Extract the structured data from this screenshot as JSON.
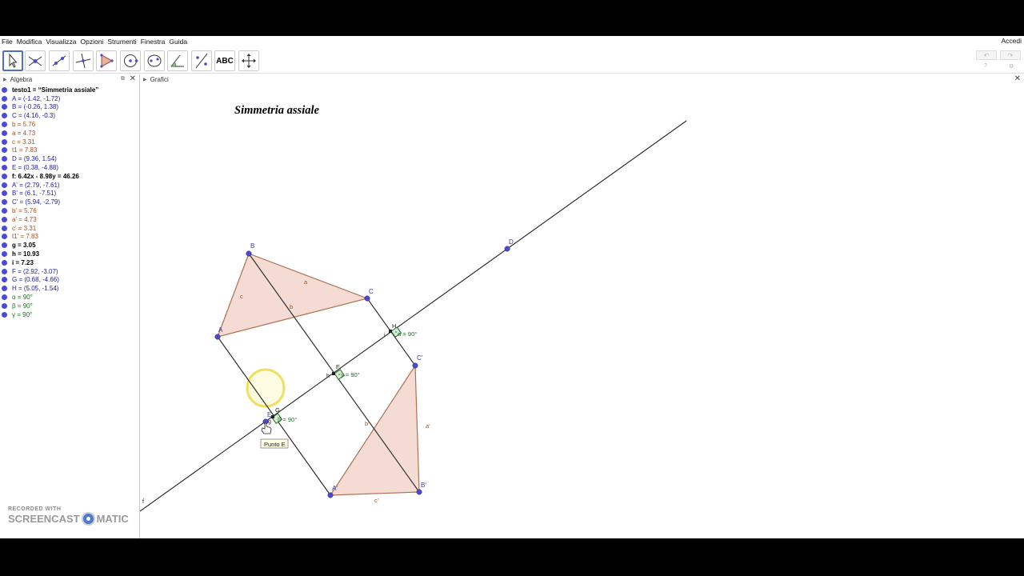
{
  "menu": [
    "File",
    "Modifica",
    "Visualizza",
    "Opzioni",
    "Strumenti",
    "Finestra",
    "Guida"
  ],
  "login_label": "Accedi",
  "toolbar": {
    "tools": [
      {
        "icon": "move-pointer-icon",
        "active": true
      },
      {
        "icon": "point-icon"
      },
      {
        "icon": "line-icon"
      },
      {
        "icon": "perpendicular-line-icon"
      },
      {
        "icon": "polygon-icon"
      },
      {
        "icon": "circle-icon"
      },
      {
        "icon": "ellipse-icon"
      },
      {
        "icon": "angle-icon"
      },
      {
        "icon": "reflect-icon"
      },
      {
        "icon": "text-tool-icon",
        "label": "ABC"
      },
      {
        "icon": "move-view-icon"
      }
    ],
    "undo_icon": "undo-icon",
    "redo_icon": "redo-icon"
  },
  "algebra": {
    "title": "Algebra",
    "rows": [
      {
        "text": "testo1 = “Simmetria assiale”",
        "color": "#000000",
        "bold": true,
        "dot": "#4a4ad8"
      },
      {
        "text": "A = (-1.42, -1.72)",
        "color": "#2020a0",
        "dot": "#4a4ad8"
      },
      {
        "text": "B = (-0.26, 1.38)",
        "color": "#2020a0",
        "dot": "#4a4ad8"
      },
      {
        "text": "C = (4.16, -0.3)",
        "color": "#2020a0",
        "dot": "#4a4ad8"
      },
      {
        "text": "b = 5.76",
        "color": "#a05020",
        "dot": "#4a4ad8"
      },
      {
        "text": "a = 4.73",
        "color": "#a05020",
        "dot": "#4a4ad8"
      },
      {
        "text": "c = 3.31",
        "color": "#a05020",
        "dot": "#4a4ad8"
      },
      {
        "text": "t1 = 7.83",
        "color": "#a05020",
        "dot": "#4a4ad8"
      },
      {
        "text": "D = (9.36, 1.54)",
        "color": "#2020a0",
        "dot": "#4a4ad8"
      },
      {
        "text": "E = (0.38, -4.88)",
        "color": "#2020a0",
        "dot": "#4a4ad8"
      },
      {
        "text": "f: 6.42x - 8.98y = 46.26",
        "color": "#000000",
        "bold": true,
        "dot": "#4a4ad8"
      },
      {
        "text": "A' = (2.79, -7.61)",
        "color": "#2020a0",
        "dot": "#4a4ad8"
      },
      {
        "text": "B' = (6.1, -7.51)",
        "color": "#2020a0",
        "dot": "#4a4ad8"
      },
      {
        "text": "C' = (5.94, -2.79)",
        "color": "#2020a0",
        "dot": "#4a4ad8"
      },
      {
        "text": "b' = 5.76",
        "color": "#a05020",
        "dot": "#4a4ad8"
      },
      {
        "text": "a' = 4.73",
        "color": "#a05020",
        "dot": "#4a4ad8"
      },
      {
        "text": "c' = 3.31",
        "color": "#a05020",
        "dot": "#4a4ad8"
      },
      {
        "text": "t1' = 7.83",
        "color": "#a05020",
        "dot": "#4a4ad8"
      },
      {
        "text": "g = 3.05",
        "color": "#000000",
        "bold": true,
        "dot": "#4a4ad8"
      },
      {
        "text": "h = 10.93",
        "color": "#000000",
        "bold": true,
        "dot": "#4a4ad8"
      },
      {
        "text": "i = 7.23",
        "color": "#000000",
        "bold": true,
        "dot": "#4a4ad8"
      },
      {
        "text": "F = (2.92, -3.07)",
        "color": "#2020a0",
        "dot": "#4a4ad8"
      },
      {
        "text": "G = (0.68, -4.66)",
        "color": "#2020a0",
        "dot": "#4a4ad8"
      },
      {
        "text": "H = (5.05, -1.54)",
        "color": "#2020a0",
        "dot": "#4a4ad8"
      },
      {
        "text": "α = 90°",
        "color": "#207020",
        "dot": "#4a4ad8"
      },
      {
        "text": "β = 90°",
        "color": "#207020",
        "dot": "#4a4ad8"
      },
      {
        "text": "γ = 90°",
        "color": "#207020",
        "dot": "#4a4ad8"
      }
    ]
  },
  "graphics": {
    "title": "Grafici",
    "text_object": "Simmetria assiale",
    "tooltip": "Punto E",
    "colors": {
      "point": "#4a4ad8",
      "triangle_fill": "#f4dcd4",
      "triangle_edge": "#b07050",
      "angle": "#207020",
      "line": "#303030"
    },
    "point_labels": {
      "A": "A",
      "B": "B",
      "C": "C",
      "D": "D",
      "E": "E",
      "F": "F",
      "G": "G",
      "H": "H",
      "A1": "A'",
      "B1": "B'",
      "C1": "C'"
    },
    "segment_labels": {
      "a": "a",
      "b": "b",
      "c": "c",
      "a1": "a'",
      "b1": "b'",
      "c1": "c'",
      "f": "f",
      "g": "g",
      "h": "h",
      "i": "i"
    },
    "angles": [
      {
        "symbol": "α",
        "value": "90°"
      },
      {
        "symbol": "γ",
        "value": "90°"
      },
      {
        "symbol": "β",
        "value": "90°"
      }
    ]
  },
  "watermark": {
    "top": "RECORDED WITH",
    "left": "SCREENCAST",
    "right": "MATIC"
  }
}
